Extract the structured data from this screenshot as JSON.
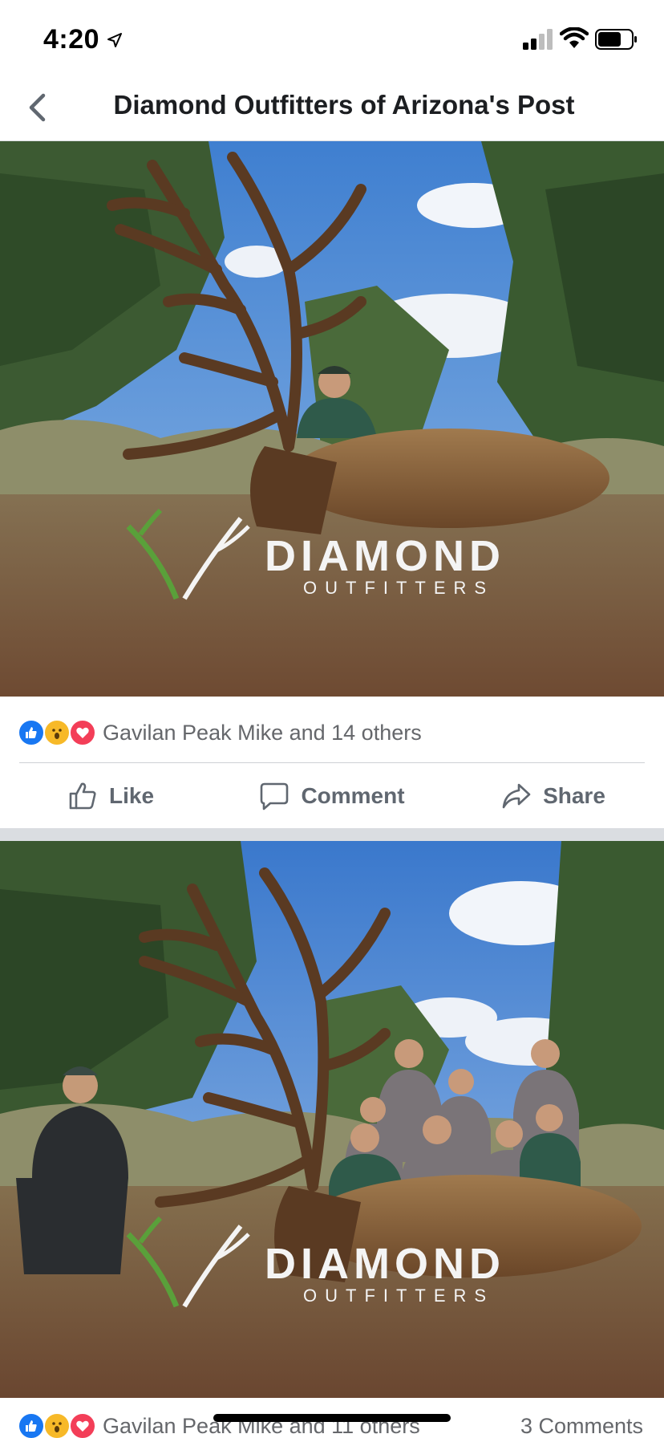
{
  "status_bar": {
    "time": "4:20",
    "icons": [
      "location-arrow-icon",
      "cellular-signal-icon",
      "wifi-icon",
      "battery-icon"
    ]
  },
  "nav": {
    "title": "Diamond Outfitters of Arizona's Post",
    "back_icon": "chevron-left-icon"
  },
  "posts": [
    {
      "photo_watermark": {
        "brand": "DIAMOND",
        "sub": "OUTFITTERS"
      },
      "reactions": {
        "icons": [
          "like",
          "wow",
          "love"
        ],
        "text": "Gavilan Peak Mike and 14 others"
      },
      "actions": {
        "like": "Like",
        "comment": "Comment",
        "share": "Share"
      }
    },
    {
      "photo_watermark": {
        "brand": "DIAMOND",
        "sub": "OUTFITTERS"
      },
      "reactions": {
        "icons": [
          "like",
          "wow",
          "love"
        ],
        "text": "Gavilan Peak Mike and 11 others",
        "comments": "3 Comments"
      }
    }
  ],
  "colors": {
    "accent_like": "#1877f2",
    "wow": "#f7b928",
    "love": "#f33e58",
    "secondary_text": "#65676b",
    "action_text": "#606770"
  }
}
